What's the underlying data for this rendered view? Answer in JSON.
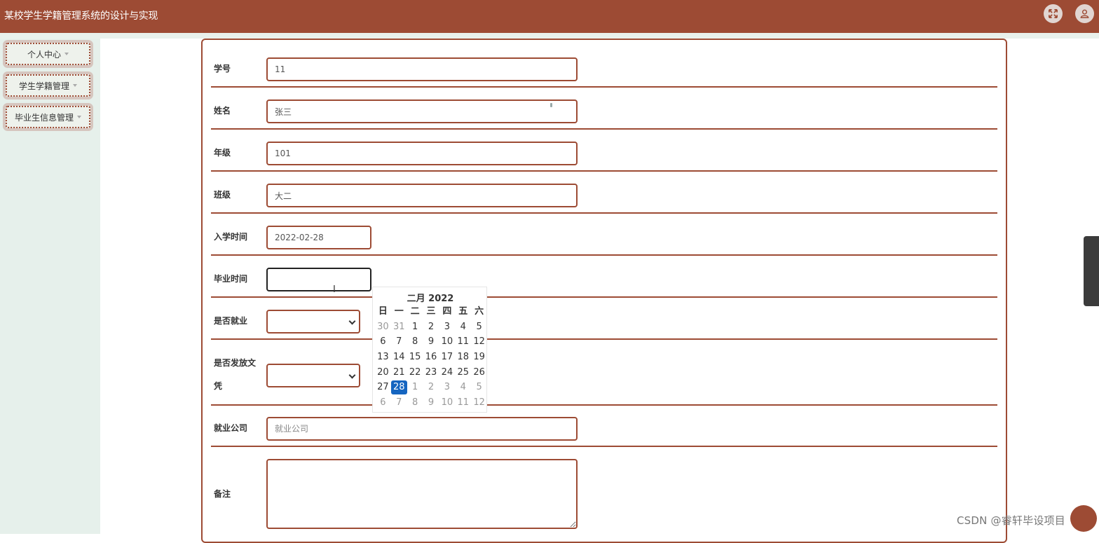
{
  "app": {
    "title": "某校学生学籍管理系统的设计与实现"
  },
  "header": {
    "fullscreen_icon": "expand-icon",
    "user_icon": "user-icon"
  },
  "sidebar": {
    "items": [
      {
        "label": "个人中心"
      },
      {
        "label": "学生学籍管理"
      },
      {
        "label": "毕业生信息管理"
      }
    ]
  },
  "form": {
    "student_id": {
      "label": "学号",
      "value": "11"
    },
    "name": {
      "label": "姓名",
      "value": "张三"
    },
    "grade": {
      "label": "年级",
      "value": "101"
    },
    "class": {
      "label": "班级",
      "value": "大二"
    },
    "enroll_date": {
      "label": "入学时间",
      "value": "2022-02-28"
    },
    "grad_date": {
      "label": "毕业时间",
      "value": ""
    },
    "employed": {
      "label": "是否就业",
      "value": ""
    },
    "diploma": {
      "label_line1": "是否发放文",
      "label_line2": "凭",
      "value": ""
    },
    "company": {
      "label": "就业公司",
      "placeholder": "就业公司",
      "value": ""
    },
    "remarks": {
      "label": "备注",
      "value": ""
    }
  },
  "calendar": {
    "title": "二月 2022",
    "weekdays": [
      "日",
      "一",
      "二",
      "三",
      "四",
      "五",
      "六"
    ],
    "weeks": [
      [
        "30",
        "31",
        "1",
        "2",
        "3",
        "4",
        "5"
      ],
      [
        "6",
        "7",
        "8",
        "9",
        "10",
        "11",
        "12"
      ],
      [
        "13",
        "14",
        "15",
        "16",
        "17",
        "18",
        "19"
      ],
      [
        "20",
        "21",
        "22",
        "23",
        "24",
        "25",
        "26"
      ],
      [
        "27",
        "28",
        "1",
        "2",
        "3",
        "4",
        "5"
      ],
      [
        "6",
        "7",
        "8",
        "9",
        "10",
        "11",
        "12"
      ]
    ],
    "selected": "28",
    "colors": {
      "selected": "#1565c0",
      "muted": "#999999"
    }
  },
  "theme": {
    "brand": "#9d4b34",
    "sidebar_bg": "#e6f0eb"
  },
  "watermark": "CSDN @睿轩毕设项目"
}
